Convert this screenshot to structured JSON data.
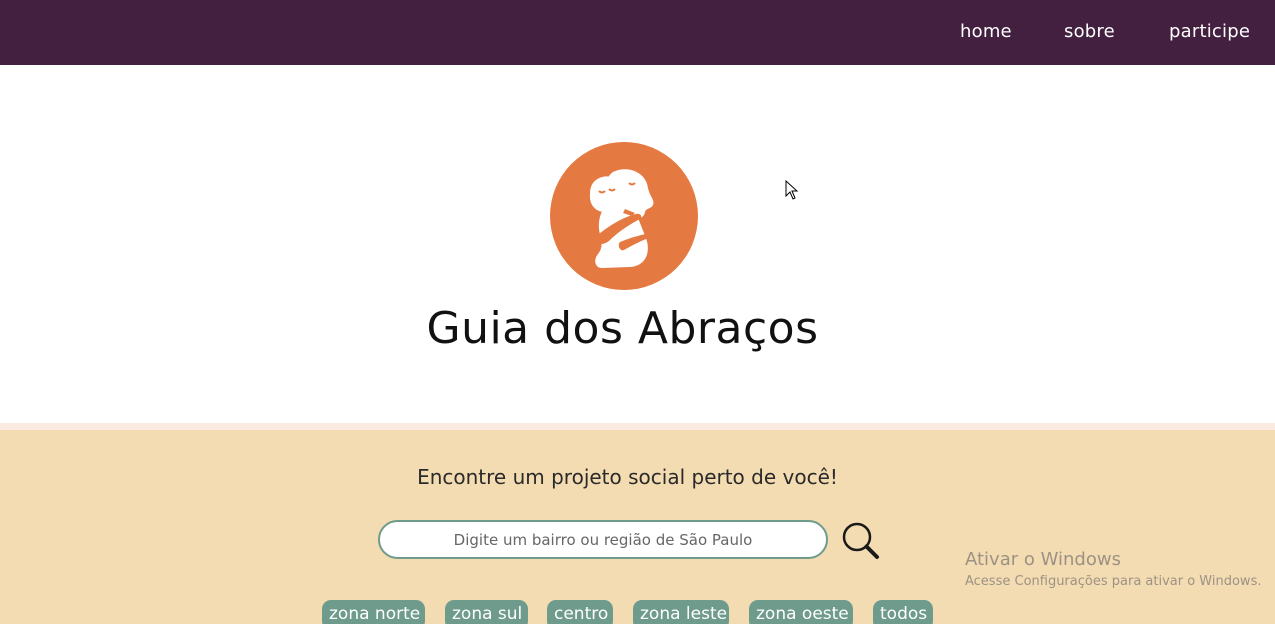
{
  "nav": {
    "items": [
      {
        "label": "home"
      },
      {
        "label": "sobre"
      },
      {
        "label": "participe"
      }
    ]
  },
  "hero": {
    "brand": "Guia dos Abraços",
    "logo_icon": "hug-icon"
  },
  "search": {
    "tagline": "Encontre um projeto social perto de você!",
    "placeholder": "Digite um bairro ou região de São Paulo",
    "value": "",
    "button_icon": "search-icon"
  },
  "filters": [
    {
      "label": "zona norte"
    },
    {
      "label": "zona sul"
    },
    {
      "label": "centro"
    },
    {
      "label": "zona leste"
    },
    {
      "label": "zona oeste"
    },
    {
      "label": "todos"
    }
  ],
  "watermark": {
    "title": "Ativar o Windows",
    "subtitle": "Acesse Configurações para ativar o Windows."
  },
  "colors": {
    "nav_bg": "#432040",
    "accent_orange": "#e57942",
    "search_bg": "#f4dcb2",
    "chip_bg": "#6e9b8c"
  }
}
